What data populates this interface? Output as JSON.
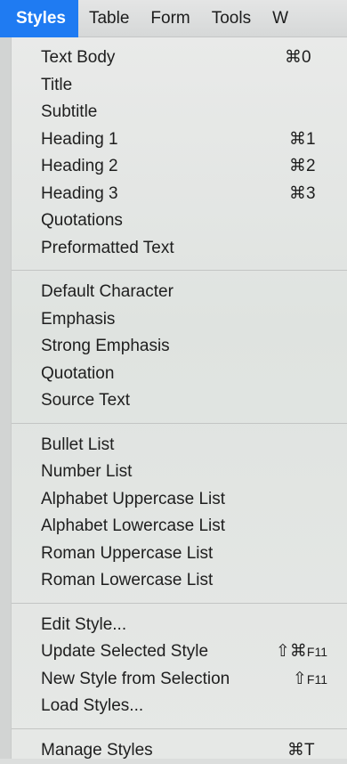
{
  "menubar": {
    "items": [
      {
        "label": "Styles",
        "active": true
      },
      {
        "label": "Table",
        "active": false
      },
      {
        "label": "Form",
        "active": false
      },
      {
        "label": "Tools",
        "active": false
      },
      {
        "label": "W",
        "active": false
      }
    ]
  },
  "menu": {
    "groups": [
      {
        "items": [
          {
            "label": "Text Body",
            "shortcut": "⌘0"
          },
          {
            "label": "Title",
            "shortcut": ""
          },
          {
            "label": "Subtitle",
            "shortcut": ""
          },
          {
            "label": "Heading 1",
            "shortcut": "⌘1"
          },
          {
            "label": "Heading 2",
            "shortcut": "⌘2"
          },
          {
            "label": "Heading 3",
            "shortcut": "⌘3"
          },
          {
            "label": "Quotations",
            "shortcut": ""
          },
          {
            "label": "Preformatted Text",
            "shortcut": ""
          }
        ]
      },
      {
        "items": [
          {
            "label": "Default Character",
            "shortcut": ""
          },
          {
            "label": "Emphasis",
            "shortcut": ""
          },
          {
            "label": "Strong Emphasis",
            "shortcut": ""
          },
          {
            "label": "Quotation",
            "shortcut": ""
          },
          {
            "label": "Source Text",
            "shortcut": ""
          }
        ]
      },
      {
        "items": [
          {
            "label": "Bullet List",
            "shortcut": ""
          },
          {
            "label": "Number List",
            "shortcut": ""
          },
          {
            "label": "Alphabet Uppercase List",
            "shortcut": ""
          },
          {
            "label": "Alphabet Lowercase List",
            "shortcut": ""
          },
          {
            "label": "Roman Uppercase List",
            "shortcut": ""
          },
          {
            "label": "Roman Lowercase List",
            "shortcut": ""
          }
        ]
      },
      {
        "items": [
          {
            "label": "Edit Style...",
            "shortcut": ""
          },
          {
            "label": "Update Selected Style",
            "shortcut_mod": "⇧⌘",
            "shortcut_key": "F11"
          },
          {
            "label": "New Style from Selection",
            "shortcut_mod": "⇧",
            "shortcut_key": "F11"
          },
          {
            "label": "Load Styles...",
            "shortcut": ""
          }
        ]
      },
      {
        "items": [
          {
            "label": "Manage Styles",
            "shortcut": "⌘T"
          }
        ]
      }
    ]
  },
  "colors": {
    "accent": "#1f7bf2",
    "menu_bg": "#e4e6e4",
    "text": "#1e1e1e"
  }
}
